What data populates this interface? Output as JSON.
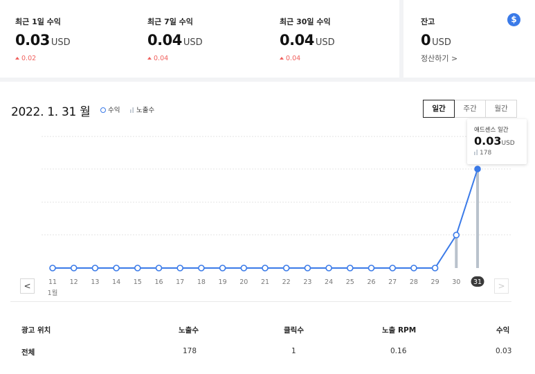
{
  "stats": [
    {
      "label": "최근 1일 수익",
      "value": "0.03",
      "unit": "USD",
      "delta": "0.02"
    },
    {
      "label": "최근 7일 수익",
      "value": "0.04",
      "unit": "USD",
      "delta": "0.04"
    },
    {
      "label": "최근 30일 수익",
      "value": "0.04",
      "unit": "USD",
      "delta": "0.04"
    }
  ],
  "balance": {
    "label": "잔고",
    "value": "0",
    "unit": "USD",
    "settle_link": "정산하기 >",
    "icon": "dollar-icon"
  },
  "main": {
    "date": "2022. 1. 31 월",
    "legend_revenue": "수익",
    "legend_impressions": "노출수",
    "period_buttons": [
      "일간",
      "주간",
      "월간"
    ],
    "active_period": "일간"
  },
  "chart_data": {
    "type": "line",
    "x": [
      "11",
      "12",
      "13",
      "14",
      "15",
      "16",
      "17",
      "18",
      "19",
      "20",
      "21",
      "22",
      "23",
      "24",
      "25",
      "26",
      "27",
      "28",
      "29",
      "30",
      "31"
    ],
    "x_sublabel": "1월",
    "selected": "31",
    "series": [
      {
        "name": "수익",
        "type": "line",
        "values": [
          0,
          0,
          0,
          0,
          0,
          0,
          0,
          0,
          0,
          0,
          0,
          0,
          0,
          0,
          0,
          0,
          0,
          0,
          0,
          0.01,
          0.03
        ]
      },
      {
        "name": "노출수",
        "type": "bar",
        "values": [
          0,
          0,
          0,
          0,
          0,
          0,
          0,
          0,
          0,
          0,
          0,
          0,
          0,
          0,
          0,
          0,
          0,
          0,
          0,
          62,
          178
        ]
      }
    ],
    "colors": {
      "line": "#3a7ae8",
      "bar": "#b9c2cc"
    }
  },
  "tooltip": {
    "title": "애드센스 일간",
    "value": "0.03",
    "unit": "USD",
    "impressions": "178"
  },
  "nav": {
    "prev": "<",
    "next": ">"
  },
  "table": {
    "headers": [
      "광고 위치",
      "노출수",
      "클릭수",
      "노출 RPM",
      "수익"
    ],
    "rows": [
      [
        "전체",
        "178",
        "1",
        "0.16",
        "0.03"
      ]
    ]
  }
}
